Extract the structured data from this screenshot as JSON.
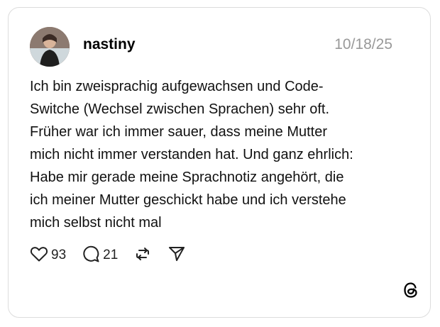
{
  "post": {
    "username": "nastiny",
    "date": "10/18/25",
    "text": "Ich bin zweisprachig aufgewachsen und Code-\nSwitche (Wechsel zwischen Sprachen) sehr oft.\nFrüher war ich immer sauer, dass meine Mutter\nmich nicht immer verstanden hat. Und ganz ehrlich:\nHabe mir gerade meine Sprachnotiz angehört, die\nich meiner Mutter geschickt habe und ich verstehe\nmich selbst nicht mal"
  },
  "actions": {
    "likes": "93",
    "comments": "21"
  },
  "icons": [
    "heart-icon",
    "comment-icon",
    "repost-icon",
    "share-icon",
    "threads-logo-icon"
  ]
}
